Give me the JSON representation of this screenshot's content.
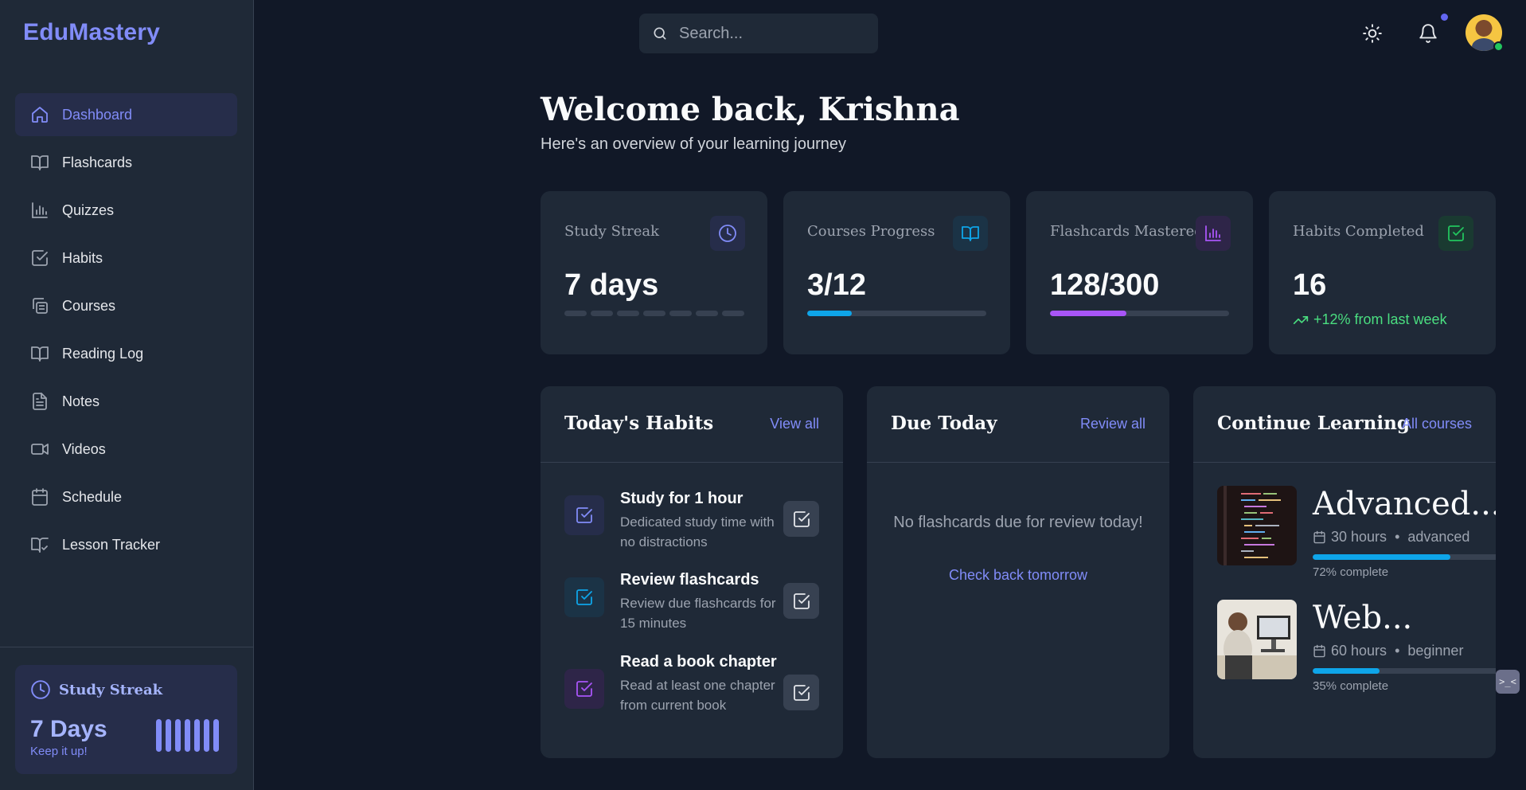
{
  "brand": "EduMastery",
  "sidebar": {
    "items": [
      {
        "label": "Dashboard",
        "icon": "home-icon"
      },
      {
        "label": "Flashcards",
        "icon": "book-open-icon"
      },
      {
        "label": "Quizzes",
        "icon": "bar-chart-icon"
      },
      {
        "label": "Habits",
        "icon": "check-square-icon"
      },
      {
        "label": "Courses",
        "icon": "copy-icon"
      },
      {
        "label": "Reading Log",
        "icon": "book-open-icon"
      },
      {
        "label": "Notes",
        "icon": "file-text-icon"
      },
      {
        "label": "Videos",
        "icon": "video-icon"
      },
      {
        "label": "Schedule",
        "icon": "calendar-icon"
      },
      {
        "label": "Lesson Tracker",
        "icon": "book-check-icon"
      }
    ],
    "streak": {
      "title": "Study Streak",
      "value": "7 Days",
      "subtitle": "Keep it up!",
      "bars": 7
    }
  },
  "search": {
    "placeholder": "Search..."
  },
  "welcome": {
    "title": "Welcome back, Krishna",
    "subtitle": "Here's an overview of your learning journey"
  },
  "stats": [
    {
      "label": "Study Streak",
      "value": "7 days",
      "icon": "clock-icon",
      "segments": 7
    },
    {
      "label": "Courses Progress",
      "value": "3/12",
      "icon": "book-open-icon",
      "progress": 0.25,
      "color": "#0ea5e9"
    },
    {
      "label": "Flashcards Mastered",
      "value": "128/300",
      "icon": "bar-chart-icon",
      "progress": 0.427,
      "color": "#a855f7"
    },
    {
      "label": "Habits Completed",
      "value": "16",
      "icon": "check-square-icon",
      "trend": "+12% from last week"
    }
  ],
  "habits_panel": {
    "title": "Today's Habits",
    "link": "View all",
    "items": [
      {
        "name": "Study for 1 hour",
        "desc": "Dedicated study time with no distractions"
      },
      {
        "name": "Review flashcards",
        "desc": "Review due flashcards for 15 minutes"
      },
      {
        "name": "Read a book chapter",
        "desc": "Read at least one chapter from current book"
      }
    ]
  },
  "due_panel": {
    "title": "Due Today",
    "link": "Review all",
    "empty": "No flashcards due for review today!",
    "empty_link": "Check back tomorrow"
  },
  "courses_panel": {
    "title": "Continue Learning",
    "link": "All courses",
    "items": [
      {
        "name": "Advanced...",
        "hours": "30 hours",
        "level": "advanced",
        "progress": 0.72,
        "pct_label": "72% complete"
      },
      {
        "name": "Web...",
        "hours": "60 hours",
        "level": "beginner",
        "progress": 0.35,
        "pct_label": "35% complete"
      }
    ]
  },
  "colors": {
    "accent": "#818cf8",
    "bg": "#111827",
    "card": "#1f2937",
    "success": "#4ade80"
  }
}
